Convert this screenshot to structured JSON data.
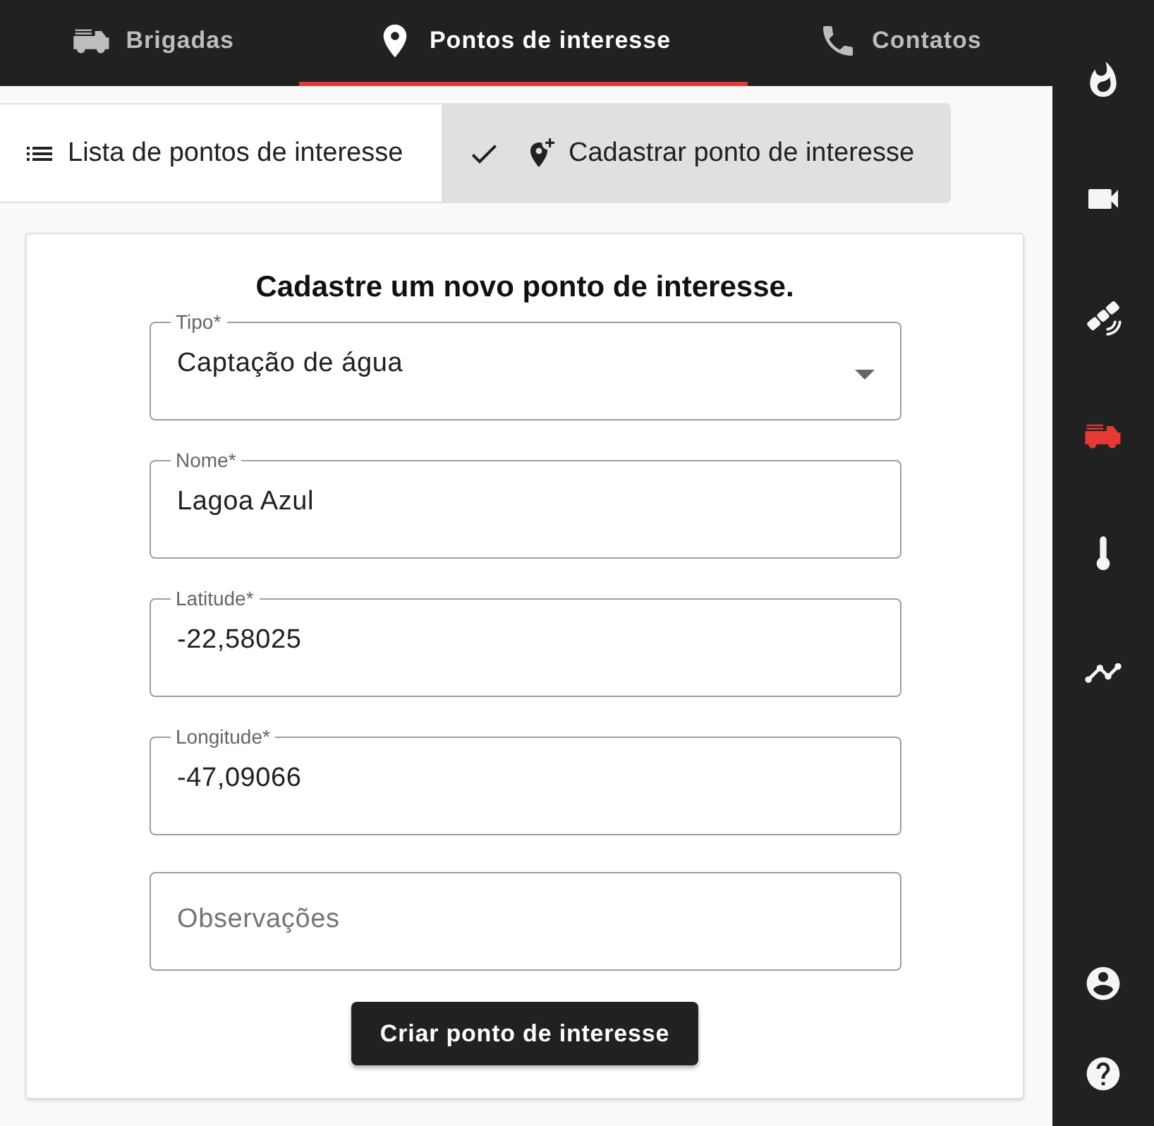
{
  "top_tabs": [
    {
      "kind": "brigades",
      "label": "Brigadas",
      "selected": false
    },
    {
      "kind": "places",
      "label": "Pontos de interesse",
      "selected": true
    },
    {
      "kind": "contacts",
      "label": "Contatos",
      "selected": false
    }
  ],
  "view_toggle": [
    {
      "kind": "list",
      "label": "Lista de pontos de interesse",
      "selected": false
    },
    {
      "kind": "add",
      "label": "Cadastrar ponto de interesse",
      "selected": true
    }
  ],
  "form": {
    "title": "Cadastre um novo ponto de interesse.",
    "fields": [
      {
        "kind": "select",
        "label": "Tipo*",
        "value": "Captação de água"
      },
      {
        "kind": "text",
        "label": "Nome*",
        "value": "Lagoa Azul"
      },
      {
        "kind": "text",
        "label": "Latitude*",
        "value": "-22,58025"
      },
      {
        "kind": "text",
        "label": "Longitude*",
        "value": "-47,09066"
      },
      {
        "kind": "text",
        "placeholder": "Observações"
      }
    ],
    "submit": "Criar ponto de interesse"
  },
  "sidebar": {
    "items": [
      {
        "kind": "fire",
        "selected": false
      },
      {
        "kind": "camera",
        "selected": false
      },
      {
        "kind": "satellite",
        "selected": false
      },
      {
        "kind": "truck",
        "selected": true
      },
      {
        "kind": "thermometer",
        "selected": false
      },
      {
        "kind": "chart",
        "selected": false
      }
    ],
    "bottom_items": [
      {
        "kind": "account"
      },
      {
        "kind": "help"
      }
    ]
  }
}
